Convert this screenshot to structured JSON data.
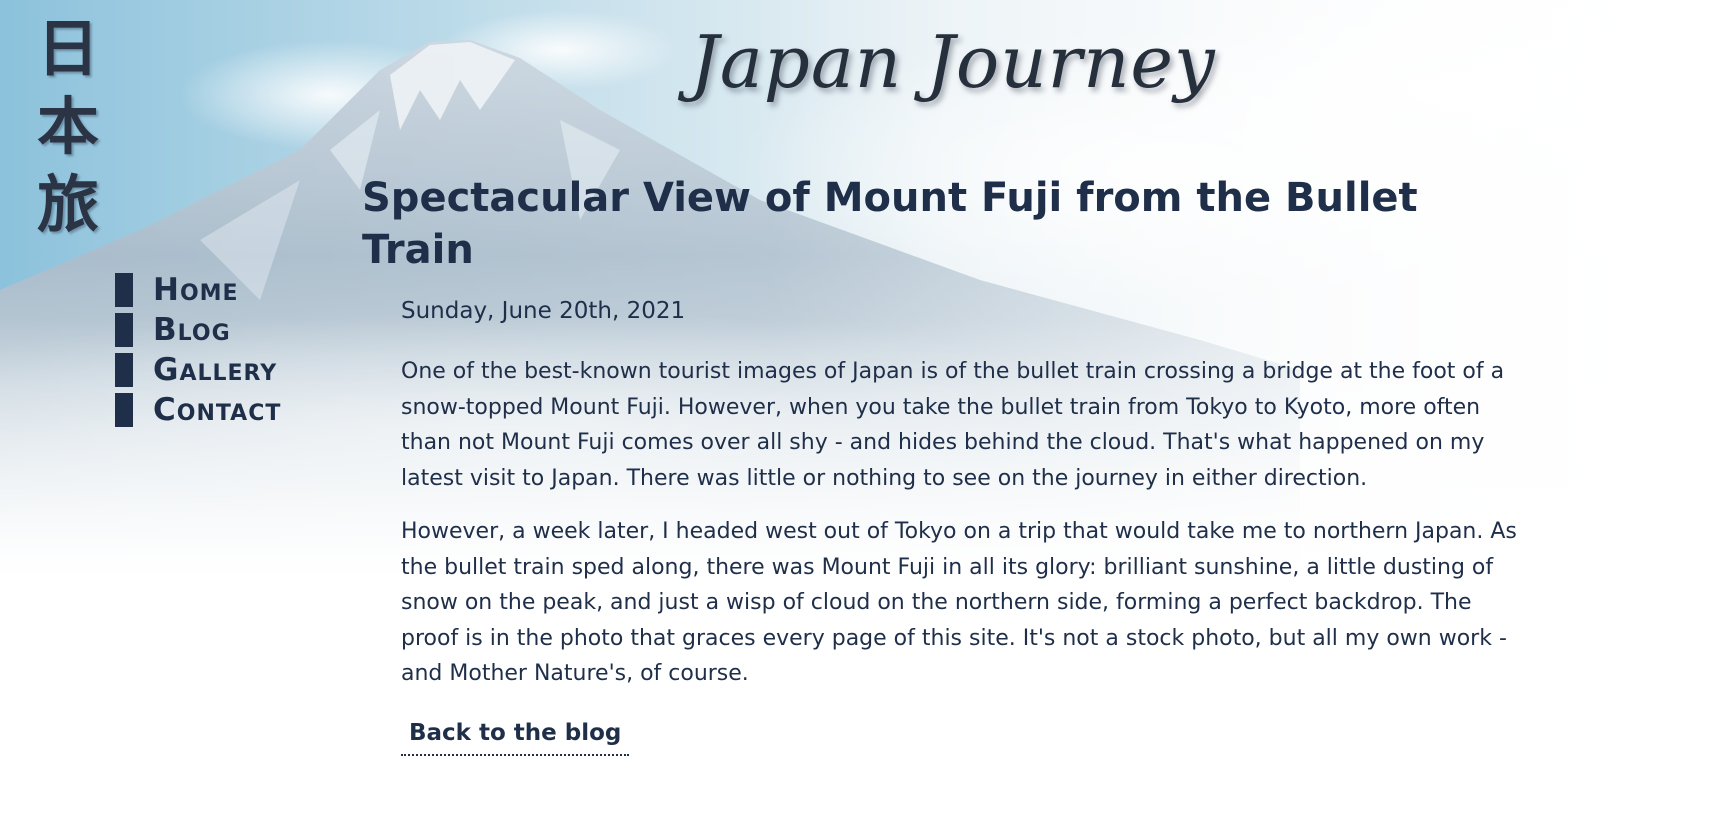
{
  "site": {
    "logo_kanji": [
      "日",
      "本",
      "旅"
    ],
    "title": "Japan Journey"
  },
  "nav": {
    "items": [
      {
        "label": "Home"
      },
      {
        "label": "Blog"
      },
      {
        "label": "Gallery"
      },
      {
        "label": "Contact"
      }
    ]
  },
  "article": {
    "title": "Spectacular View of Mount Fuji from the Bullet Train",
    "date": "Sunday, June 20th, 2021",
    "paragraphs": [
      "One of the best-known tourist images of Japan is of the bullet train crossing a bridge at the foot of a snow-topped Mount Fuji. However, when you take the bullet train from Tokyo to Kyoto, more often than not Mount Fuji comes over all shy - and hides behind the cloud. That's what happened on my latest visit to Japan. There was little or nothing to see on the journey in either direction.",
      "However, a week later, I headed west out of Tokyo on a trip that would take me to northern Japan. As the bullet train sped along, there was Mount Fuji in all its glory: brilliant sunshine, a little dusting of snow on the peak, and just a wisp of cloud on the northern side, forming a perfect backdrop. The proof is in the photo that graces every page of this site. It's not a stock photo, but all my own work - and Mother Nature's, of course."
    ],
    "back_link_label": "Back to the blog"
  },
  "colors": {
    "text": "#1f2f4a",
    "sky": "#8fc3dc",
    "background": "#ffffff"
  }
}
